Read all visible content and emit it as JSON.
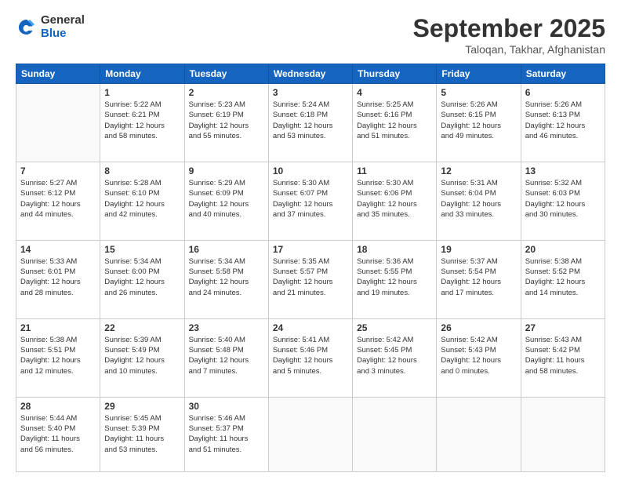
{
  "header": {
    "logo_general": "General",
    "logo_blue": "Blue",
    "title": "September 2025",
    "location": "Taloqan, Takhar, Afghanistan"
  },
  "weekdays": [
    "Sunday",
    "Monday",
    "Tuesday",
    "Wednesday",
    "Thursday",
    "Friday",
    "Saturday"
  ],
  "weeks": [
    [
      {
        "day": "",
        "content": ""
      },
      {
        "day": "1",
        "content": "Sunrise: 5:22 AM\nSunset: 6:21 PM\nDaylight: 12 hours\nand 58 minutes."
      },
      {
        "day": "2",
        "content": "Sunrise: 5:23 AM\nSunset: 6:19 PM\nDaylight: 12 hours\nand 55 minutes."
      },
      {
        "day": "3",
        "content": "Sunrise: 5:24 AM\nSunset: 6:18 PM\nDaylight: 12 hours\nand 53 minutes."
      },
      {
        "day": "4",
        "content": "Sunrise: 5:25 AM\nSunset: 6:16 PM\nDaylight: 12 hours\nand 51 minutes."
      },
      {
        "day": "5",
        "content": "Sunrise: 5:26 AM\nSunset: 6:15 PM\nDaylight: 12 hours\nand 49 minutes."
      },
      {
        "day": "6",
        "content": "Sunrise: 5:26 AM\nSunset: 6:13 PM\nDaylight: 12 hours\nand 46 minutes."
      }
    ],
    [
      {
        "day": "7",
        "content": "Sunrise: 5:27 AM\nSunset: 6:12 PM\nDaylight: 12 hours\nand 44 minutes."
      },
      {
        "day": "8",
        "content": "Sunrise: 5:28 AM\nSunset: 6:10 PM\nDaylight: 12 hours\nand 42 minutes."
      },
      {
        "day": "9",
        "content": "Sunrise: 5:29 AM\nSunset: 6:09 PM\nDaylight: 12 hours\nand 40 minutes."
      },
      {
        "day": "10",
        "content": "Sunrise: 5:30 AM\nSunset: 6:07 PM\nDaylight: 12 hours\nand 37 minutes."
      },
      {
        "day": "11",
        "content": "Sunrise: 5:30 AM\nSunset: 6:06 PM\nDaylight: 12 hours\nand 35 minutes."
      },
      {
        "day": "12",
        "content": "Sunrise: 5:31 AM\nSunset: 6:04 PM\nDaylight: 12 hours\nand 33 minutes."
      },
      {
        "day": "13",
        "content": "Sunrise: 5:32 AM\nSunset: 6:03 PM\nDaylight: 12 hours\nand 30 minutes."
      }
    ],
    [
      {
        "day": "14",
        "content": "Sunrise: 5:33 AM\nSunset: 6:01 PM\nDaylight: 12 hours\nand 28 minutes."
      },
      {
        "day": "15",
        "content": "Sunrise: 5:34 AM\nSunset: 6:00 PM\nDaylight: 12 hours\nand 26 minutes."
      },
      {
        "day": "16",
        "content": "Sunrise: 5:34 AM\nSunset: 5:58 PM\nDaylight: 12 hours\nand 24 minutes."
      },
      {
        "day": "17",
        "content": "Sunrise: 5:35 AM\nSunset: 5:57 PM\nDaylight: 12 hours\nand 21 minutes."
      },
      {
        "day": "18",
        "content": "Sunrise: 5:36 AM\nSunset: 5:55 PM\nDaylight: 12 hours\nand 19 minutes."
      },
      {
        "day": "19",
        "content": "Sunrise: 5:37 AM\nSunset: 5:54 PM\nDaylight: 12 hours\nand 17 minutes."
      },
      {
        "day": "20",
        "content": "Sunrise: 5:38 AM\nSunset: 5:52 PM\nDaylight: 12 hours\nand 14 minutes."
      }
    ],
    [
      {
        "day": "21",
        "content": "Sunrise: 5:38 AM\nSunset: 5:51 PM\nDaylight: 12 hours\nand 12 minutes."
      },
      {
        "day": "22",
        "content": "Sunrise: 5:39 AM\nSunset: 5:49 PM\nDaylight: 12 hours\nand 10 minutes."
      },
      {
        "day": "23",
        "content": "Sunrise: 5:40 AM\nSunset: 5:48 PM\nDaylight: 12 hours\nand 7 minutes."
      },
      {
        "day": "24",
        "content": "Sunrise: 5:41 AM\nSunset: 5:46 PM\nDaylight: 12 hours\nand 5 minutes."
      },
      {
        "day": "25",
        "content": "Sunrise: 5:42 AM\nSunset: 5:45 PM\nDaylight: 12 hours\nand 3 minutes."
      },
      {
        "day": "26",
        "content": "Sunrise: 5:42 AM\nSunset: 5:43 PM\nDaylight: 12 hours\nand 0 minutes."
      },
      {
        "day": "27",
        "content": "Sunrise: 5:43 AM\nSunset: 5:42 PM\nDaylight: 11 hours\nand 58 minutes."
      }
    ],
    [
      {
        "day": "28",
        "content": "Sunrise: 5:44 AM\nSunset: 5:40 PM\nDaylight: 11 hours\nand 56 minutes."
      },
      {
        "day": "29",
        "content": "Sunrise: 5:45 AM\nSunset: 5:39 PM\nDaylight: 11 hours\nand 53 minutes."
      },
      {
        "day": "30",
        "content": "Sunrise: 5:46 AM\nSunset: 5:37 PM\nDaylight: 11 hours\nand 51 minutes."
      },
      {
        "day": "",
        "content": ""
      },
      {
        "day": "",
        "content": ""
      },
      {
        "day": "",
        "content": ""
      },
      {
        "day": "",
        "content": ""
      }
    ]
  ]
}
